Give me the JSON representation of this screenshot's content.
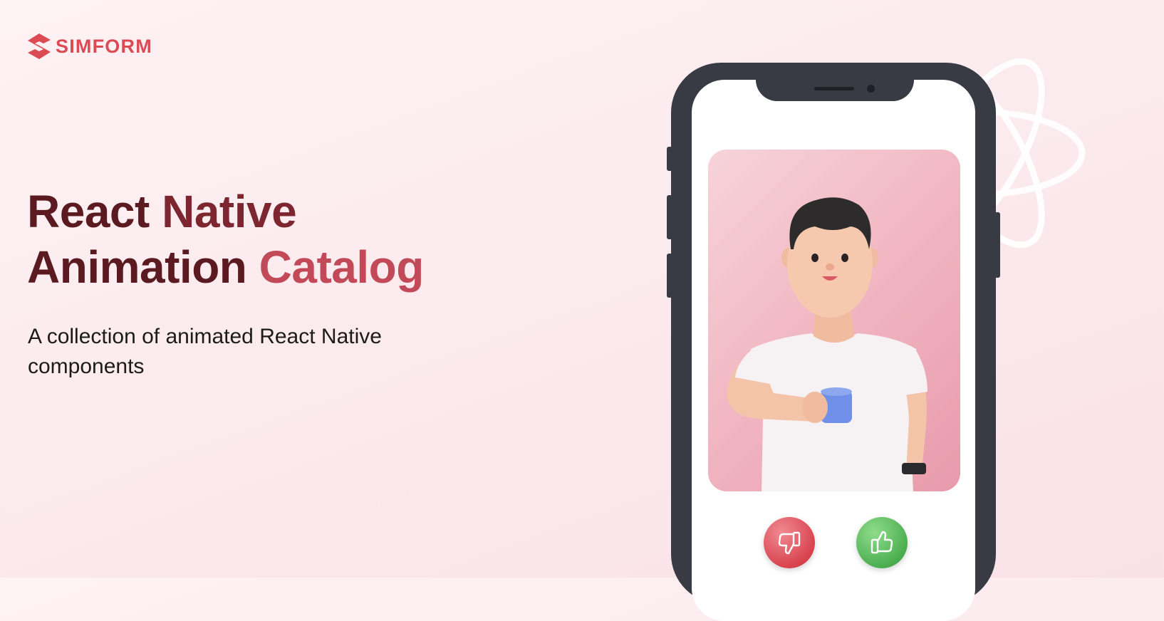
{
  "brand": {
    "name": "SIMFORM",
    "color": "#dc4a54"
  },
  "hero": {
    "title_line1_a": "React ",
    "title_line1_b": "Native",
    "title_line2_a": "Animation ",
    "title_line2_b": "Catalog",
    "subtitle": "A collection of animated React Native components"
  },
  "phone": {
    "card_illustration": "3d-character-holding-mug",
    "actions": [
      {
        "name": "dislike",
        "icon": "thumbs-down-icon",
        "color": "#d9444f"
      },
      {
        "name": "like",
        "icon": "thumbs-up-icon",
        "color": "#4caf50"
      }
    ]
  },
  "decor": {
    "icon": "react-atom-icon"
  }
}
